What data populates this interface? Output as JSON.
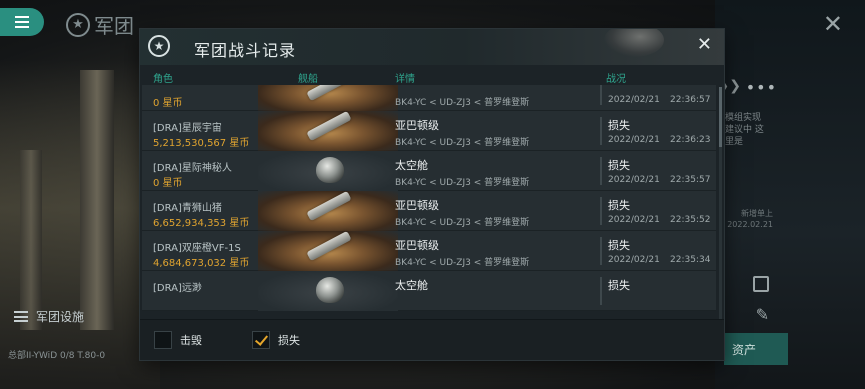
{
  "background": {
    "page_title": "军团",
    "facility_label": "军团设施",
    "assets_button": "资产",
    "bottom_text": "总部II-YWiD  0/8  T.80-0",
    "side_text": "模组实现 建议中 这里是",
    "side_text2": "新增单上 2022.02.21"
  },
  "dialog": {
    "title": "军团战斗记录",
    "columns": {
      "character": "角色",
      "ship": "舰船",
      "details": "详情",
      "status": "战况"
    },
    "rows": [
      {
        "name": "",
        "value": "0 星币",
        "ship_type": "",
        "route": "BK4-YC < UD-ZJ3 < 普罗维登斯",
        "status": "",
        "date": "2022/02/21",
        "time": "22:36:57",
        "image": "glow",
        "ship_icon": "ship"
      },
      {
        "name": "[DRA]星辰宇宙",
        "value": "5,213,530,567 星币",
        "ship_type": "亚巴顿级",
        "route": "BK4-YC < UD-ZJ3 < 普罗维登斯",
        "status": "损失",
        "date": "2022/02/21",
        "time": "22:36:23",
        "image": "glow",
        "ship_icon": "ship"
      },
      {
        "name": "[DRA]星际神秘人",
        "value": "0 星币",
        "ship_type": "太空舱",
        "route": "BK4-YC < UD-ZJ3 < 普罗维登斯",
        "status": "损失",
        "date": "2022/02/21",
        "time": "22:35:57",
        "image": "dark",
        "ship_icon": "pod"
      },
      {
        "name": "[DRA]青狮山猪",
        "value": "6,652,934,353 星币",
        "ship_type": "亚巴顿级",
        "route": "BK4-YC < UD-ZJ3 < 普罗维登斯",
        "status": "损失",
        "date": "2022/02/21",
        "time": "22:35:52",
        "image": "glow",
        "ship_icon": "ship"
      },
      {
        "name": "[DRA]双座橙VF-1S",
        "value": "4,684,673,032 星币",
        "ship_type": "亚巴顿级",
        "route": "BK4-YC < UD-ZJ3 < 普罗维登斯",
        "status": "损失",
        "date": "2022/02/21",
        "time": "22:35:34",
        "image": "glow",
        "ship_icon": "ship"
      },
      {
        "name": "[DRA]远渺",
        "value": "",
        "ship_type": "太空舱",
        "route": "",
        "status": "损失",
        "date": "",
        "time": "",
        "image": "dark",
        "ship_icon": "pod"
      }
    ],
    "filters": {
      "kill_label": "击毁",
      "kill_checked": false,
      "loss_label": "损失",
      "loss_checked": true
    }
  },
  "colors": {
    "accent": "#2a8f80",
    "isk_value": "#e0a430",
    "header_label": "#2fa58e",
    "check": "#e5a62b"
  }
}
